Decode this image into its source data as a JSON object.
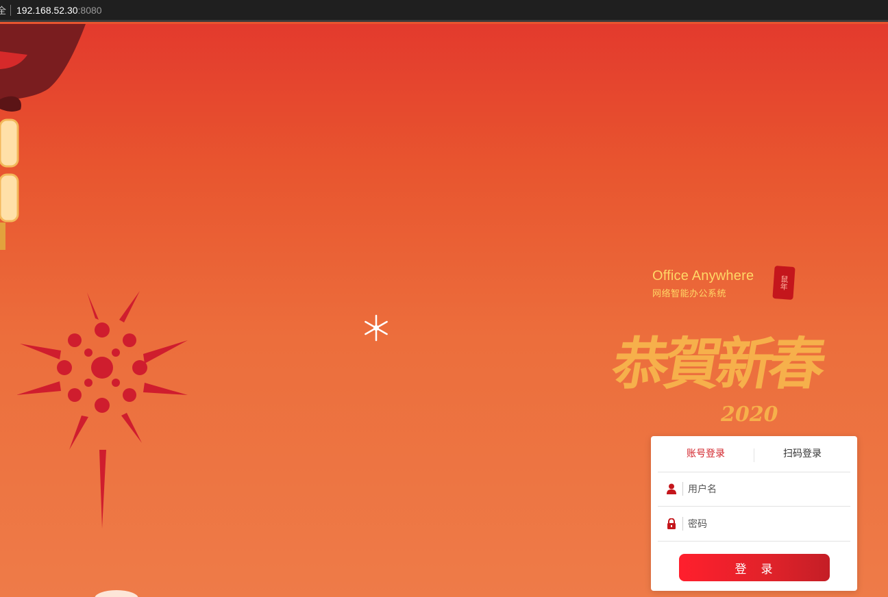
{
  "browser": {
    "lock_glyph": "全",
    "host": "192.168.52.30",
    "port": ":8080"
  },
  "brand": {
    "name_en": "Office Anywhere",
    "name_cn": "网络智能办公系统",
    "seal_text": "鼠年"
  },
  "greeting": {
    "text": "恭賀新春",
    "year": "2020"
  },
  "login": {
    "tabs": [
      {
        "label": "账号登录",
        "active": true
      },
      {
        "label": "扫码登录",
        "active": false
      }
    ],
    "username": {
      "placeholder": "用户名",
      "value": "",
      "icon": "user-icon"
    },
    "password": {
      "placeholder": "密码",
      "value": "",
      "icon": "lock-icon"
    },
    "submit_label": "登　录"
  },
  "colors": {
    "accent": "#d2232a",
    "gold": "#f6b04b",
    "background": "#e8552f"
  }
}
